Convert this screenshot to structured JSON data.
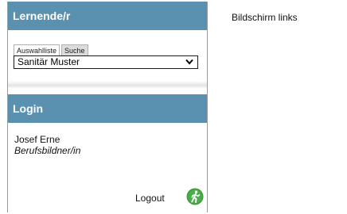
{
  "learner_section": {
    "title": "Lernende/r",
    "tabs": [
      {
        "label": "Auswahlliste",
        "active": true
      },
      {
        "label": "Suche",
        "active": false
      }
    ],
    "selected_learner": "Sanitär Muster"
  },
  "login_section": {
    "title": "Login",
    "user_name": "Josef Erne",
    "user_role": "Berufsbildner/in",
    "logout_label": "Logout"
  },
  "caption": "Bildschirm links",
  "colors": {
    "header_bg": "#5a91b1",
    "header_text": "#ffffff",
    "logout_icon": "#3c9b3c"
  },
  "icons": {
    "select_chevron": "chevron-down-icon",
    "logout": "logout-icon"
  }
}
